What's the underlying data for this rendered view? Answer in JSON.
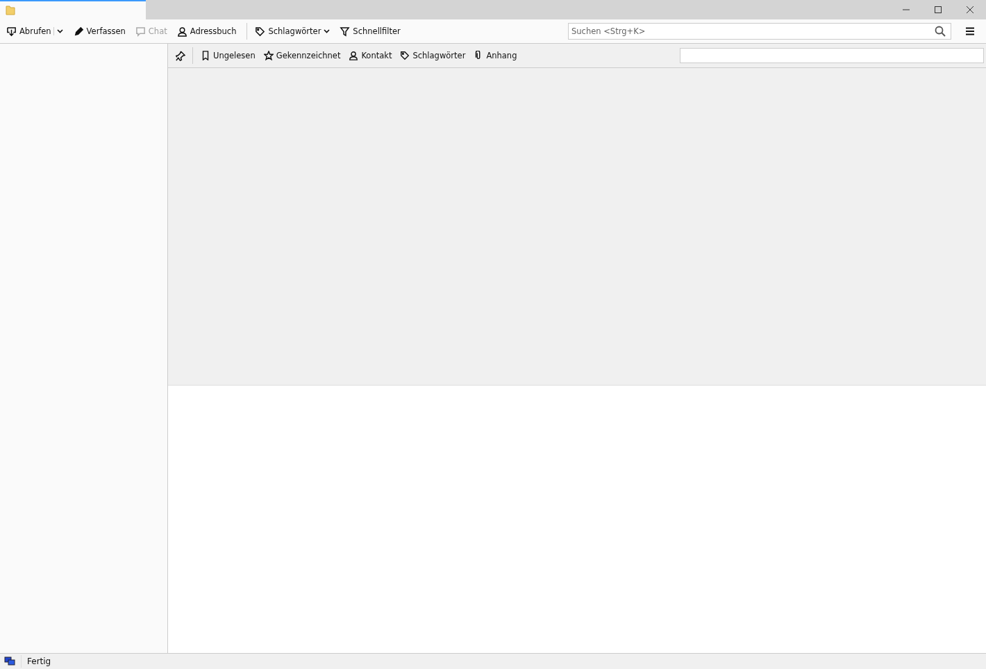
{
  "toolbar": {
    "buttons": [
      {
        "label": "Abrufen",
        "disabled": false,
        "kind": "split"
      },
      {
        "label": "Verfassen",
        "disabled": false,
        "kind": "plain"
      },
      {
        "label": "Chat",
        "disabled": true,
        "kind": "plain"
      },
      {
        "label": "Adressbuch",
        "disabled": false,
        "kind": "plain"
      },
      {
        "label": "Schlagwörter",
        "disabled": false,
        "kind": "menu"
      },
      {
        "label": "Schnellfilter",
        "disabled": false,
        "kind": "plain"
      }
    ],
    "search": {
      "placeholder": "Suchen <Strg+K>"
    }
  },
  "filter_bar": {
    "buttons": [
      {
        "label": "Ungelesen",
        "selected": false
      },
      {
        "label": "Gekennzeichnet",
        "selected": false
      },
      {
        "label": "Kontakt",
        "selected": false
      },
      {
        "label": "Schlagwörter",
        "selected": false
      },
      {
        "label": "Anhang",
        "selected": false
      }
    ]
  },
  "status_bar": {
    "text": "Fertig"
  }
}
